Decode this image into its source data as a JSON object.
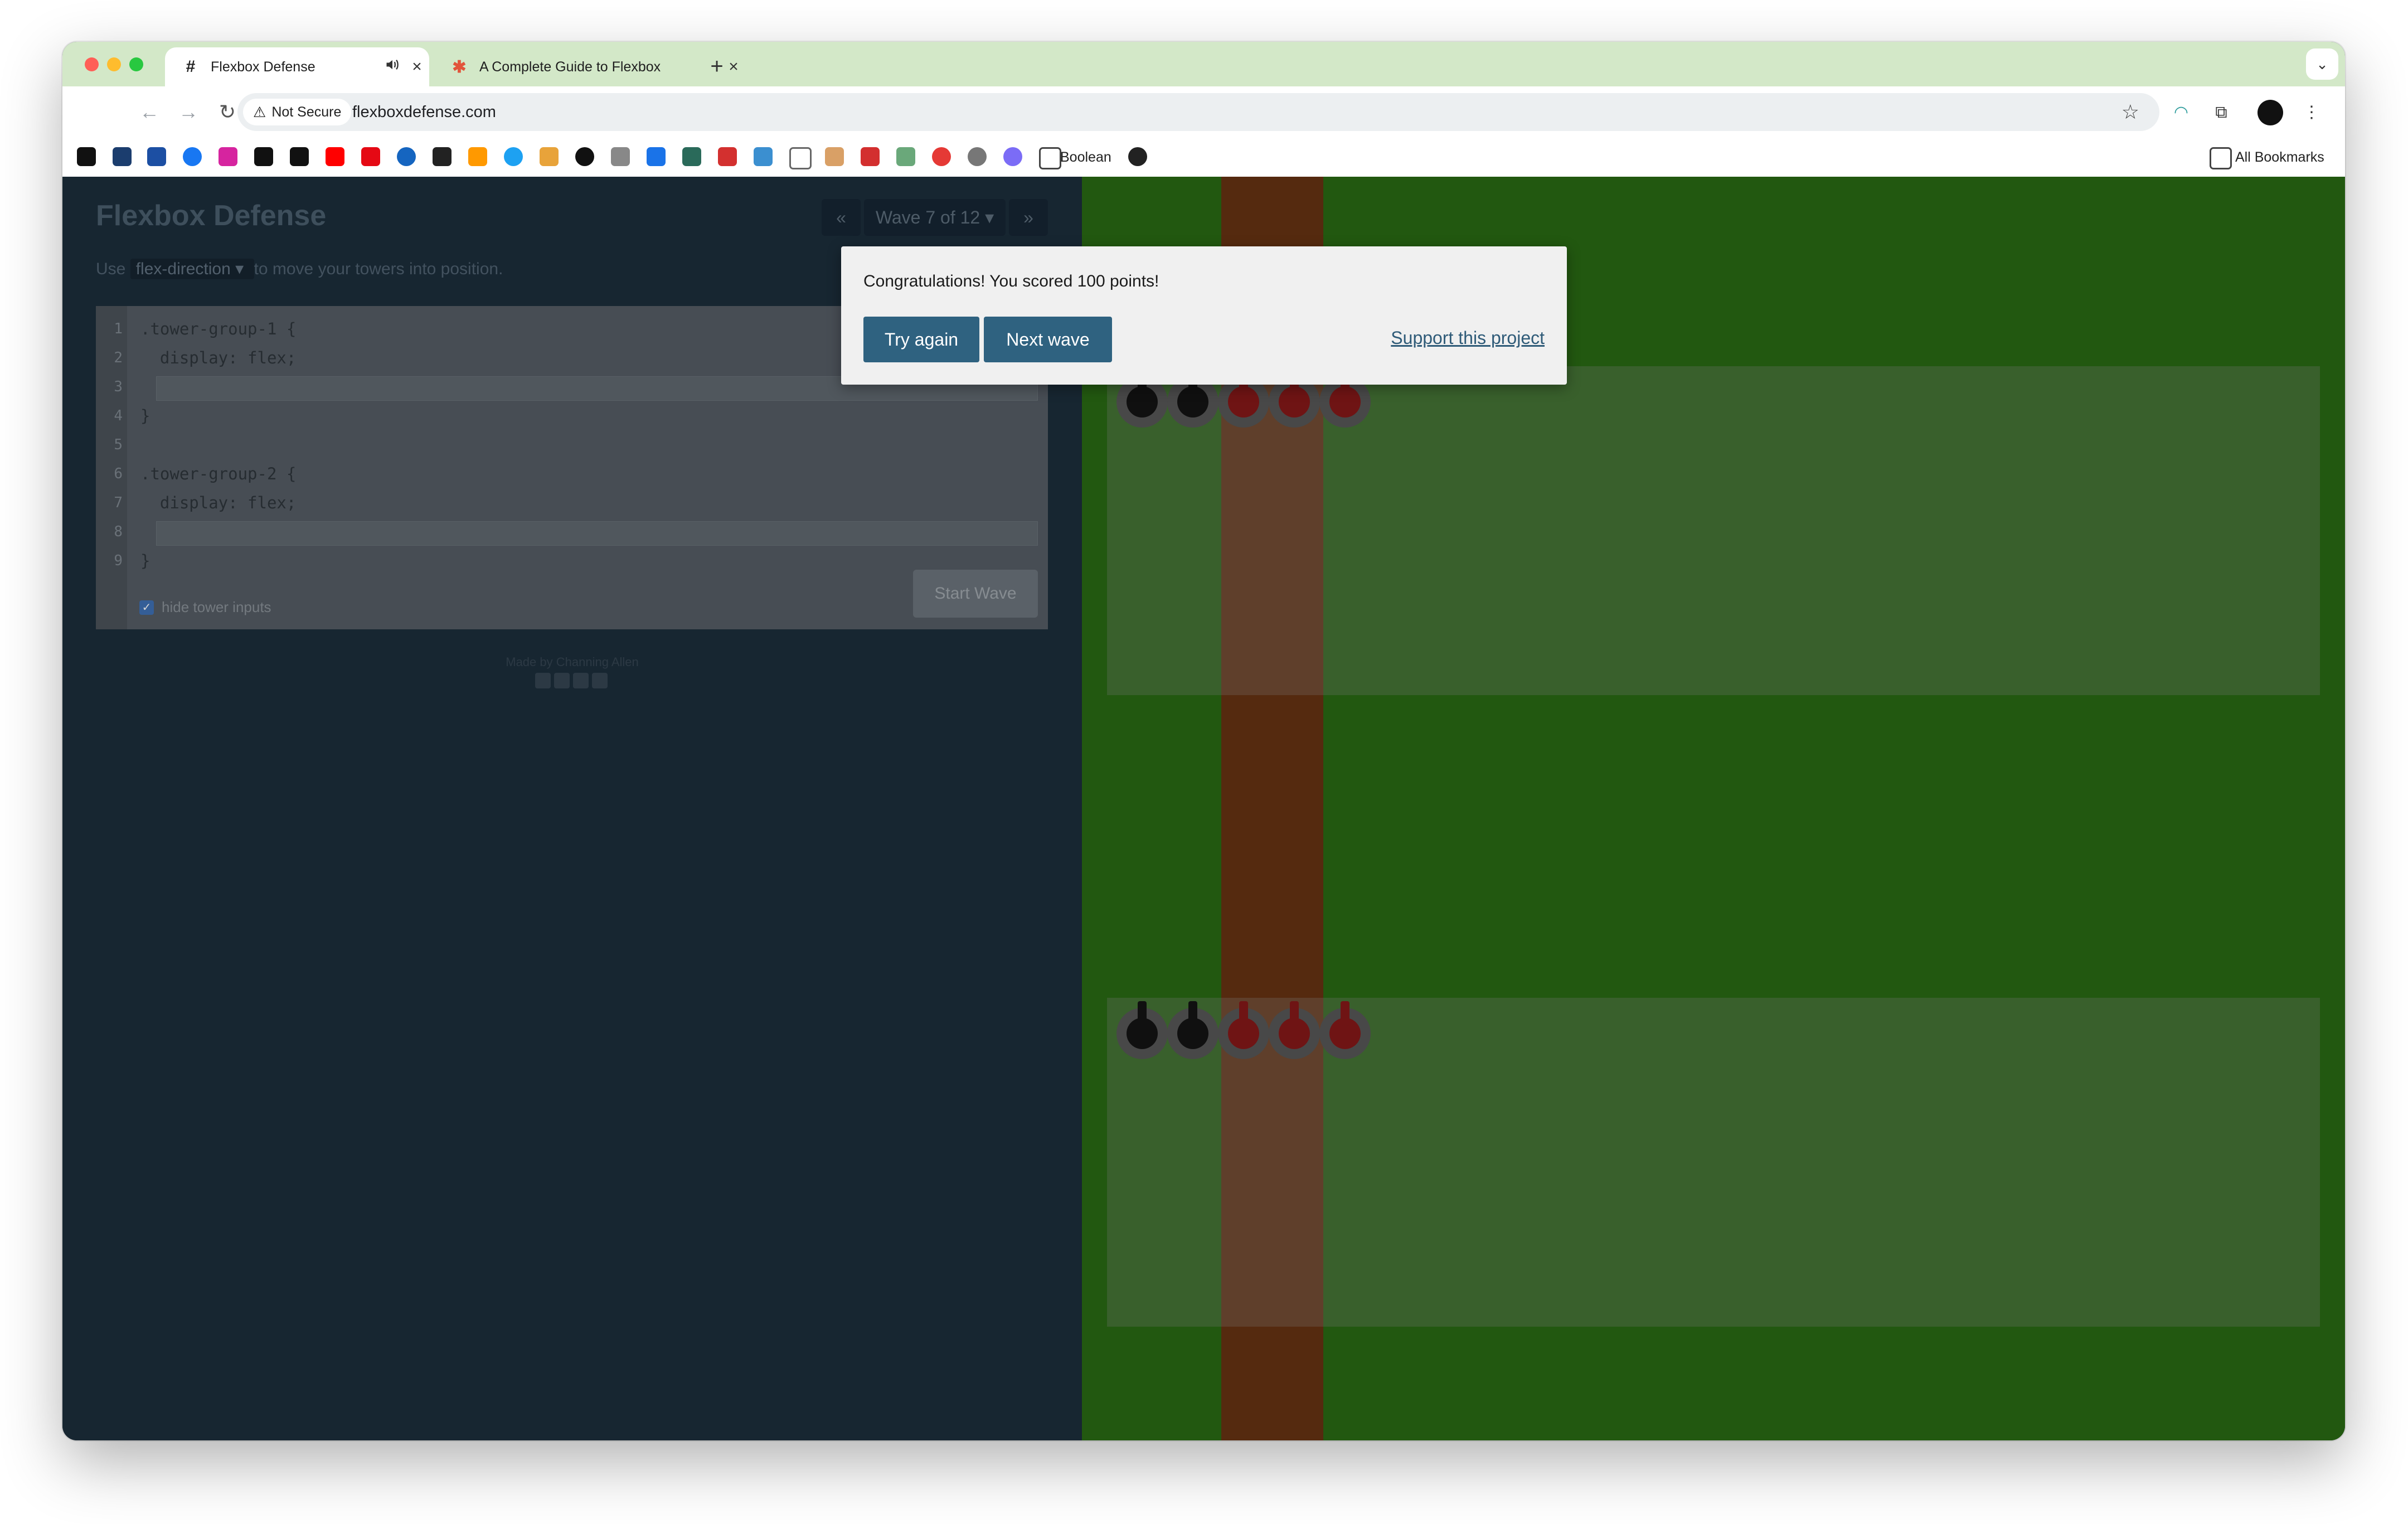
{
  "browser": {
    "tabs": [
      {
        "label": "Flexbox Defense",
        "icon": "hash-icon",
        "audio_icon": "speaker-icon"
      },
      {
        "label": "A Complete Guide to Flexbox",
        "icon": "asterisk-icon"
      }
    ],
    "address": {
      "security_label": "Not Secure",
      "url": "flexboxdefense.com"
    },
    "bookmarks": {
      "folder_label": "Boolean",
      "all_label": "All Bookmarks"
    }
  },
  "game": {
    "title": "Flexbox Defense",
    "wave_label": "Wave 7 of 12",
    "instruction": {
      "prefix": "Use",
      "property": "flex-direction",
      "suffix": "to move your towers into position."
    },
    "code_lines": [
      {
        "num": "1",
        "text": ".tower-group-1 {"
      },
      {
        "num": "2",
        "text": "  display: flex;"
      },
      {
        "num": "3",
        "text": ""
      },
      {
        "num": "4",
        "text": "}"
      },
      {
        "num": "5",
        "text": ""
      },
      {
        "num": "6",
        "text": ".tower-group-2 {"
      },
      {
        "num": "7",
        "text": "  display: flex;"
      },
      {
        "num": "8",
        "text": ""
      },
      {
        "num": "9",
        "text": "}"
      }
    ],
    "start_wave_label": "Start Wave",
    "hide_inputs_label": "hide tower inputs",
    "hide_inputs_checked": true,
    "made_by": "Made by Channing Allen",
    "tower_groups": [
      {
        "towers": [
          "black",
          "black",
          "red",
          "red",
          "red"
        ]
      },
      {
        "towers": [
          "black",
          "black",
          "red",
          "red",
          "red"
        ]
      }
    ]
  },
  "modal": {
    "message": "Congratulations! You scored 100 points!",
    "try_again_label": "Try again",
    "next_wave_label": "Next wave",
    "support_label": "Support this project"
  },
  "colors": {
    "panel": "#1a2b38",
    "grass": "#2b6e15",
    "path": "#6b3513",
    "modal_button": "#2f6280",
    "tab_strip": "#d3e8c8"
  }
}
